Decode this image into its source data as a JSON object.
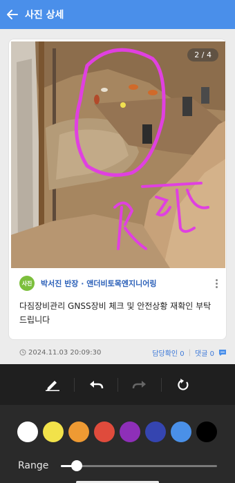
{
  "header": {
    "title": "사진 상세"
  },
  "photo": {
    "page_indicator": "2 / 4",
    "annotation_color": "#e040e0"
  },
  "post": {
    "avatar_label": "사진",
    "author": "박서진 반장 · 앤더비토목엔지니어링",
    "content": "다짐장비관리 GNSS장비 체크 및 안전상황 재확인 부탁드립니다",
    "timestamp": "2024.11.03 20:09:30",
    "confirm_label": "담당확인 0",
    "separator": "|",
    "comment_label": "댓글 0"
  },
  "toolbar": {
    "tools": [
      "pen-icon",
      "undo-icon",
      "redo-icon",
      "reset-icon"
    ]
  },
  "palette": {
    "colors": [
      "#ffffff",
      "#f2e24a",
      "#ee9a33",
      "#df4b3c",
      "#8e2fb8",
      "#3545b0",
      "#4a90e8",
      "#000000"
    ],
    "range_label": "Range",
    "range_value": 0.1
  }
}
